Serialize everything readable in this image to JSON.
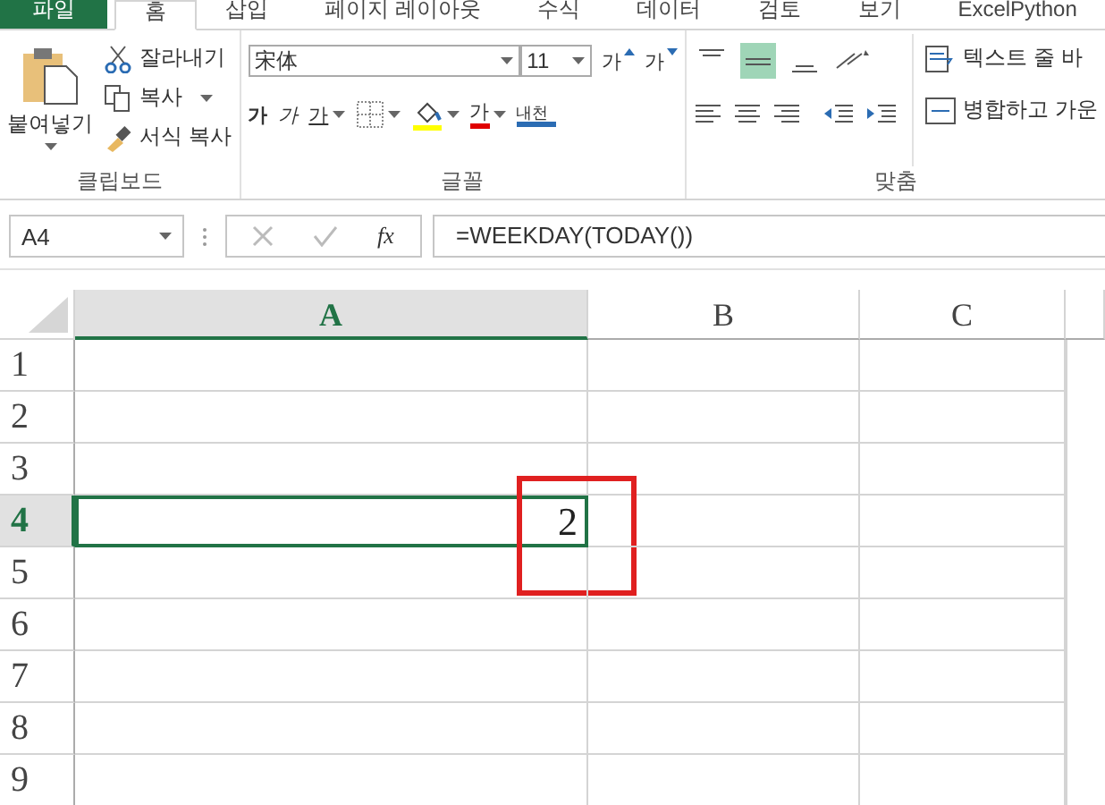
{
  "tabs": [
    {
      "label": "파일",
      "kind": "file",
      "selected": false
    },
    {
      "label": "홈",
      "kind": "tab",
      "selected": true
    },
    {
      "label": "삽입",
      "kind": "tab",
      "selected": false
    },
    {
      "label": "페이지 레이아웃",
      "kind": "tab",
      "selected": false
    },
    {
      "label": "수식",
      "kind": "tab",
      "selected": false
    },
    {
      "label": "데이터",
      "kind": "tab",
      "selected": false
    },
    {
      "label": "검토",
      "kind": "tab",
      "selected": false
    },
    {
      "label": "보기",
      "kind": "tab",
      "selected": false
    },
    {
      "label": "ExcelPython",
      "kind": "tab",
      "selected": false
    }
  ],
  "clipboard": {
    "paste": "붙여넣기",
    "cut": "잘라내기",
    "copy": "복사",
    "format_painter": "서식 복사",
    "group_label": "클립보드"
  },
  "font": {
    "font_name": "宋体",
    "font_size": "11",
    "grow": "가",
    "shrink": "가",
    "bold": "가",
    "italic": "가",
    "underline": "가",
    "font_color": "가",
    "phonetic": "내천",
    "group_label": "글꼴"
  },
  "alignment": {
    "align_buttons": [
      {
        "kind": "top",
        "selected": false
      },
      {
        "kind": "middle",
        "selected": true
      },
      {
        "kind": "bottom",
        "selected": false
      }
    ],
    "wrap_text": "텍스트 줄 바",
    "merge": "병합하고 가운",
    "group_label": "맞춤"
  },
  "formula_bar": {
    "name_box": "A4",
    "function_label": "fx",
    "formula": "=WEEKDAY(TODAY())"
  },
  "sheet": {
    "columns": [
      {
        "label": "A",
        "selected": true
      },
      {
        "label": "B",
        "selected": false
      },
      {
        "label": "C",
        "selected": false
      }
    ],
    "rows": [
      {
        "label": "1",
        "selected": false,
        "value": ""
      },
      {
        "label": "2",
        "selected": false,
        "value": ""
      },
      {
        "label": "3",
        "selected": false,
        "value": ""
      },
      {
        "label": "4",
        "selected": true,
        "value": "2"
      },
      {
        "label": "5",
        "selected": false,
        "value": ""
      },
      {
        "label": "6",
        "selected": false,
        "value": ""
      },
      {
        "label": "7",
        "selected": false,
        "value": ""
      },
      {
        "label": "8",
        "selected": false,
        "value": ""
      },
      {
        "label": "9",
        "selected": false,
        "value": ""
      }
    ]
  }
}
